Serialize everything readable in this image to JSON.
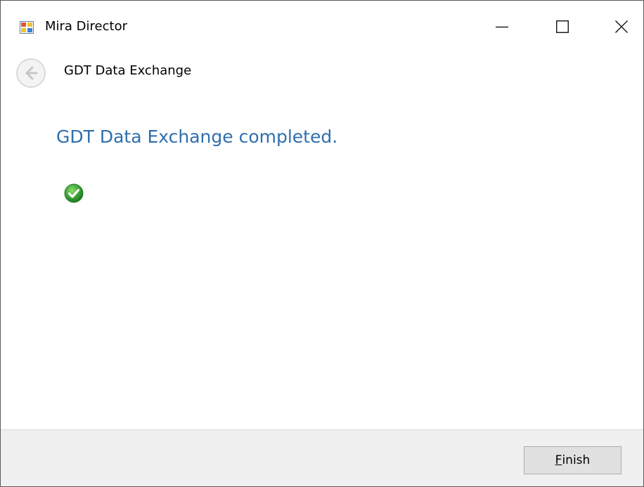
{
  "window": {
    "title": "Mira Director",
    "minimize_icon": "minimize-icon",
    "maximize_icon": "maximize-icon",
    "close_icon": "close-icon"
  },
  "nav": {
    "back_icon": "back-arrow-icon",
    "title": "GDT Data Exchange"
  },
  "main": {
    "heading": "GDT Data Exchange completed.",
    "status_icon": "success-check-icon",
    "heading_color": "#2e6fae",
    "status_color": "#3aa335"
  },
  "footer": {
    "finish_mnemonic": "F",
    "finish_rest": "inish"
  }
}
